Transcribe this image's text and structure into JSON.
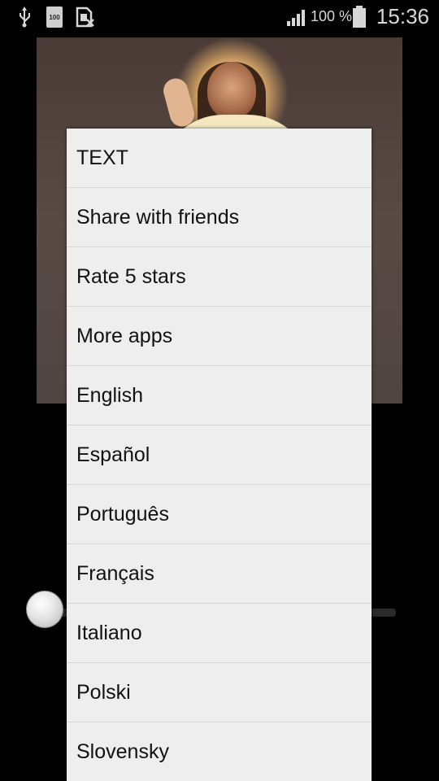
{
  "status_bar": {
    "battery_app_label": "100",
    "battery_percent": "100 %",
    "time": "15:36",
    "icons": [
      "usb-icon",
      "battery-app-icon",
      "no-sim-icon",
      "signal-icon",
      "battery-icon"
    ]
  },
  "menu": {
    "items": [
      {
        "label": "TEXT"
      },
      {
        "label": "Share with friends"
      },
      {
        "label": "Rate 5 stars"
      },
      {
        "label": "More apps"
      },
      {
        "label": "English"
      },
      {
        "label": "Español"
      },
      {
        "label": "Português"
      },
      {
        "label": "Français"
      },
      {
        "label": "Italiano"
      },
      {
        "label": "Polski"
      },
      {
        "label": "Slovensky"
      }
    ]
  },
  "colors": {
    "menu_background": "#eeeeee",
    "screen_background": "#000000",
    "status_text": "#d7d7d7"
  },
  "slider": {
    "value_fraction": 0.0
  }
}
